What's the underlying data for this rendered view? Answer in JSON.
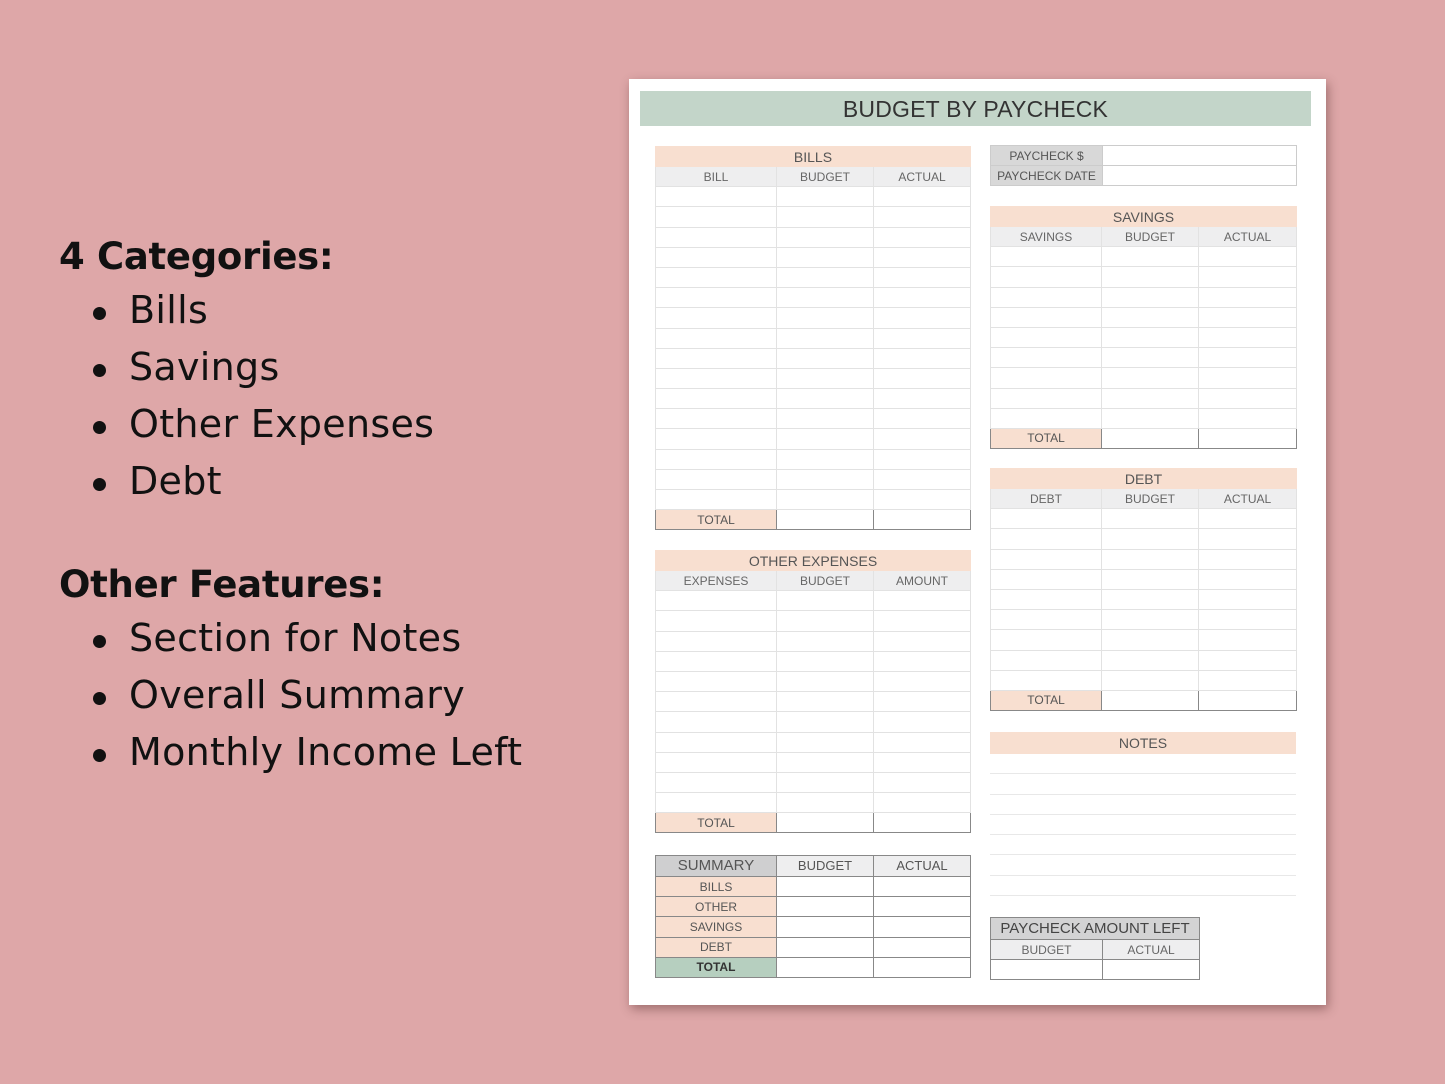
{
  "features": {
    "categories_heading": "4 Categories:",
    "categories": [
      "Bills",
      "Savings",
      "Other Expenses",
      "Debt"
    ],
    "other_heading": "Other Features:",
    "other": [
      "Section for Notes",
      "Overall Summary",
      "Monthly Income Left"
    ]
  },
  "sheet": {
    "title": "BUDGET BY PAYCHECK",
    "colors": {
      "background": "#dea7a8",
      "title_bar": "#c3d5c9",
      "section_header": "#f8dfd0",
      "summary_total": "#b6cfbf"
    },
    "paycheck": {
      "amount_label": "PAYCHECK $",
      "date_label": "PAYCHECK DATE",
      "amount_value": "",
      "date_value": ""
    },
    "bills": {
      "title": "BILLS",
      "columns": [
        "BILL",
        "BUDGET",
        "ACTUAL"
      ],
      "row_count": 16,
      "total_label": "TOTAL"
    },
    "savings": {
      "title": "SAVINGS",
      "columns": [
        "SAVINGS",
        "BUDGET",
        "ACTUAL"
      ],
      "row_count": 9,
      "total_label": "TOTAL"
    },
    "debt": {
      "title": "DEBT",
      "columns": [
        "DEBT",
        "BUDGET",
        "ACTUAL"
      ],
      "row_count": 9,
      "total_label": "TOTAL"
    },
    "other_expenses": {
      "title": "OTHER EXPENSES",
      "columns": [
        "EXPENSES",
        "BUDGET",
        "AMOUNT"
      ],
      "row_count": 11,
      "total_label": "TOTAL"
    },
    "notes": {
      "title": "NOTES",
      "line_count": 7
    },
    "summary": {
      "title": "SUMMARY",
      "columns": [
        "BUDGET",
        "ACTUAL"
      ],
      "rows": [
        "BILLS",
        "OTHER",
        "SAVINGS",
        "DEBT"
      ],
      "total_label": "TOTAL"
    },
    "paycheck_left": {
      "title": "PAYCHECK AMOUNT LEFT",
      "columns": [
        "BUDGET",
        "ACTUAL"
      ]
    }
  }
}
